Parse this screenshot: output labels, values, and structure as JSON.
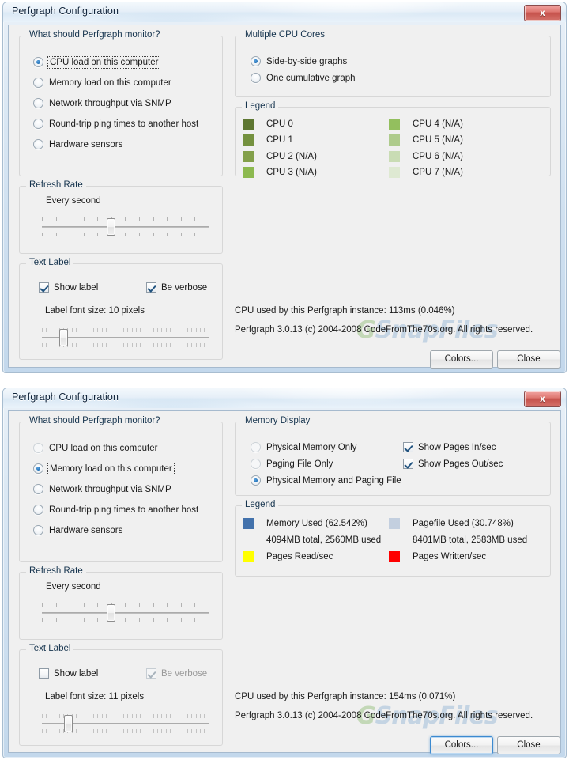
{
  "windows": [
    {
      "id": "cpu-window",
      "title": "Perfgraph Configuration",
      "close_label": "x",
      "monitor_group": {
        "title": "What should Perfgraph monitor?",
        "options": [
          {
            "label": "CPU load on this computer",
            "selected": true,
            "focused": true
          },
          {
            "label": "Memory load on this computer",
            "selected": false,
            "focused": false
          },
          {
            "label": "Network throughput via SNMP",
            "selected": false,
            "focused": false
          },
          {
            "label": "Round-trip ping times to another host",
            "selected": false,
            "focused": false
          },
          {
            "label": "Hardware sensors",
            "selected": false,
            "focused": false
          }
        ]
      },
      "refresh_group": {
        "title": "Refresh Rate",
        "value_label": "Every second",
        "slider_percent": 41
      },
      "text_label_group": {
        "title": "Text Label",
        "show_label": {
          "label": "Show label",
          "checked": true,
          "enabled": true
        },
        "be_verbose": {
          "label": "Be verbose",
          "checked": true,
          "enabled": true
        },
        "font_size_label": "Label font size: 10 pixels",
        "font_slider_percent": 11
      },
      "right_group": {
        "title": "Multiple CPU Cores",
        "options": [
          {
            "label": "Side-by-side graphs",
            "selected": true
          },
          {
            "label": "One cumulative graph",
            "selected": false
          }
        ]
      },
      "legend": {
        "title": "Legend",
        "items": [
          {
            "label": "CPU 0",
            "color": "#5e7732",
            "col": 0,
            "row": 0
          },
          {
            "label": "CPU 1",
            "color": "#74913f",
            "col": 0,
            "row": 1
          },
          {
            "label": "CPU 2 (N/A)",
            "color": "#83a04a",
            "col": 0,
            "row": 2
          },
          {
            "label": "CPU 3 (N/A)",
            "color": "#8cb94f",
            "col": 0,
            "row": 3
          },
          {
            "label": "CPU 4 (N/A)",
            "color": "#93bf5e",
            "col": 1,
            "row": 0
          },
          {
            "label": "CPU 5 (N/A)",
            "color": "#aecb8c",
            "col": 1,
            "row": 1
          },
          {
            "label": "CPU 6 (N/A)",
            "color": "#c9dcb4",
            "col": 1,
            "row": 2
          },
          {
            "label": "CPU 7 (N/A)",
            "color": "#dee9d2",
            "col": 1,
            "row": 3
          }
        ]
      },
      "status": {
        "cpu_usage": "CPU used by this Perfgraph instance: 113ms (0.046%)",
        "copyright": "Perfgraph 3.0.13 (c) 2004-2008 CodeFromThe70s.org. All rights reserved."
      },
      "buttons": {
        "colors": {
          "label": "Colors...",
          "focused": false
        },
        "close": {
          "label": "Close",
          "focused": false
        }
      }
    },
    {
      "id": "memory-window",
      "title": "Perfgraph Configuration",
      "close_label": "x",
      "monitor_group": {
        "title": "What should Perfgraph monitor?",
        "options": [
          {
            "label": "CPU load on this computer",
            "selected": false,
            "focused": false
          },
          {
            "label": "Memory load on this computer",
            "selected": true,
            "focused": true
          },
          {
            "label": "Network throughput via SNMP",
            "selected": false,
            "focused": false
          },
          {
            "label": "Round-trip ping times to another host",
            "selected": false,
            "focused": false
          },
          {
            "label": "Hardware sensors",
            "selected": false,
            "focused": false
          }
        ]
      },
      "refresh_group": {
        "title": "Refresh Rate",
        "value_label": "Every second",
        "slider_percent": 41
      },
      "text_label_group": {
        "title": "Text Label",
        "show_label": {
          "label": "Show label",
          "checked": false,
          "enabled": true
        },
        "be_verbose": {
          "label": "Be verbose",
          "checked": true,
          "enabled": false
        },
        "font_size_label": "Label font size: 11 pixels",
        "font_slider_percent": 14
      },
      "right_group": {
        "title": "Memory Display",
        "options": [
          {
            "label": "Physical Memory Only",
            "selected": false
          },
          {
            "label": "Paging File Only",
            "selected": false
          },
          {
            "label": "Physical Memory and Paging File",
            "selected": true
          }
        ],
        "checks": [
          {
            "label": "Show Pages In/sec",
            "checked": true
          },
          {
            "label": "Show Pages Out/sec",
            "checked": true
          }
        ]
      },
      "legend": {
        "title": "Legend",
        "items": [
          {
            "label": "Memory Used (62.542%)",
            "sub": "4094MB total, 2560MB used",
            "color": "#4372ac",
            "col": 0,
            "row": 0
          },
          {
            "label": "Pagefile Used (30.748%)",
            "sub": "8401MB total, 2583MB used",
            "color": "#c3cfdf",
            "col": 1,
            "row": 0
          },
          {
            "label": "Pages Read/sec",
            "sub": "",
            "color": "#ffff00",
            "col": 0,
            "row": 1
          },
          {
            "label": "Pages Written/sec",
            "sub": "",
            "color": "#fe0000",
            "col": 1,
            "row": 1
          }
        ]
      },
      "status": {
        "cpu_usage": "CPU used by this Perfgraph instance: 154ms (0.071%)",
        "copyright": "Perfgraph 3.0.13 (c) 2004-2008 CodeFromThe70s.org. All rights reserved."
      },
      "buttons": {
        "colors": {
          "label": "Colors...",
          "focused": true
        },
        "close": {
          "label": "Close",
          "focused": false
        }
      }
    }
  ],
  "watermark": {
    "prefix": "G",
    "text": "SnapFiles"
  }
}
